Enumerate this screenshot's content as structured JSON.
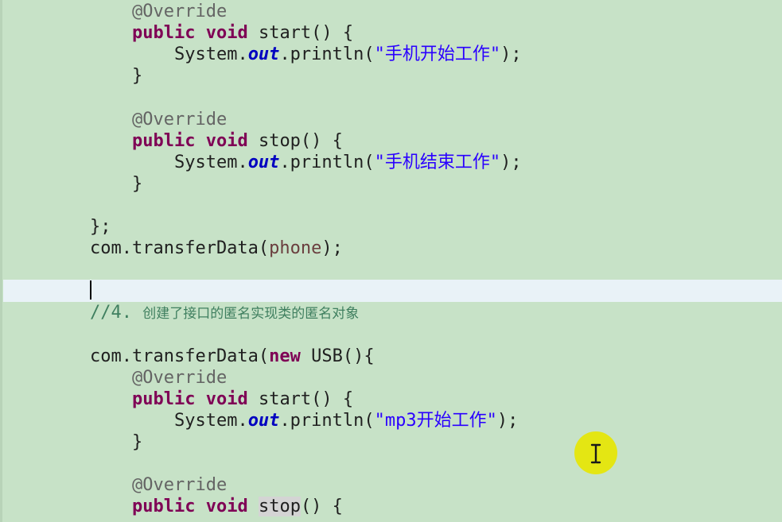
{
  "editor": {
    "lines": [
      {
        "indent": "    ",
        "tokens": [
          {
            "c": "anno",
            "t": "@Override"
          }
        ]
      },
      {
        "indent": "    ",
        "tokens": [
          {
            "c": "kw",
            "t": "public"
          },
          {
            "c": "",
            "t": " "
          },
          {
            "c": "kw",
            "t": "void"
          },
          {
            "c": "",
            "t": " start() {"
          }
        ]
      },
      {
        "indent": "        ",
        "tokens": [
          {
            "c": "",
            "t": "System."
          },
          {
            "c": "static",
            "t": "out"
          },
          {
            "c": "",
            "t": ".println("
          },
          {
            "c": "str",
            "t": "\"手机开始工作\""
          },
          {
            "c": "",
            "t": ");"
          }
        ]
      },
      {
        "indent": "    ",
        "tokens": [
          {
            "c": "",
            "t": "}"
          }
        ]
      },
      {
        "indent": "",
        "tokens": []
      },
      {
        "indent": "    ",
        "tokens": [
          {
            "c": "anno",
            "t": "@Override"
          }
        ]
      },
      {
        "indent": "    ",
        "tokens": [
          {
            "c": "kw",
            "t": "public"
          },
          {
            "c": "",
            "t": " "
          },
          {
            "c": "kw",
            "t": "void"
          },
          {
            "c": "",
            "t": " stop() {"
          }
        ]
      },
      {
        "indent": "        ",
        "tokens": [
          {
            "c": "",
            "t": "System."
          },
          {
            "c": "static",
            "t": "out"
          },
          {
            "c": "",
            "t": ".println("
          },
          {
            "c": "str",
            "t": "\"手机结束工作\""
          },
          {
            "c": "",
            "t": ");"
          }
        ]
      },
      {
        "indent": "    ",
        "tokens": [
          {
            "c": "",
            "t": "}"
          }
        ]
      },
      {
        "indent": "",
        "tokens": []
      },
      {
        "indent": "",
        "tokens": [
          {
            "c": "",
            "t": "};"
          }
        ]
      },
      {
        "indent": "",
        "tokens": [
          {
            "c": "",
            "t": "com.transferData("
          },
          {
            "c": "local",
            "t": "phone"
          },
          {
            "c": "",
            "t": ");"
          }
        ]
      },
      {
        "indent": "",
        "tokens": []
      },
      {
        "indent": "",
        "tokens": []
      },
      {
        "indent": "",
        "tokens": [
          {
            "c": "comment",
            "t": "//4. "
          },
          {
            "c": "comment cjk",
            "t": "创建了接口的匿名实现类的匿名对象"
          }
        ]
      },
      {
        "indent": "",
        "tokens": []
      },
      {
        "indent": "",
        "tokens": [
          {
            "c": "",
            "t": "com.transferData("
          },
          {
            "c": "kw",
            "t": "new"
          },
          {
            "c": "",
            "t": " USB(){"
          }
        ]
      },
      {
        "indent": "    ",
        "tokens": [
          {
            "c": "anno",
            "t": "@Override"
          }
        ]
      },
      {
        "indent": "    ",
        "tokens": [
          {
            "c": "kw",
            "t": "public"
          },
          {
            "c": "",
            "t": " "
          },
          {
            "c": "kw",
            "t": "void"
          },
          {
            "c": "",
            "t": " start() {"
          }
        ]
      },
      {
        "indent": "        ",
        "tokens": [
          {
            "c": "",
            "t": "System."
          },
          {
            "c": "static",
            "t": "out"
          },
          {
            "c": "",
            "t": ".println("
          },
          {
            "c": "str",
            "t": "\"mp3开始工作\""
          },
          {
            "c": "",
            "t": ");"
          }
        ]
      },
      {
        "indent": "    ",
        "tokens": [
          {
            "c": "",
            "t": "}"
          }
        ]
      },
      {
        "indent": "",
        "tokens": []
      },
      {
        "indent": "    ",
        "tokens": [
          {
            "c": "anno",
            "t": "@Override"
          }
        ]
      },
      {
        "indent": "    ",
        "tokens": [
          {
            "c": "kw",
            "t": "public"
          },
          {
            "c": "",
            "t": " "
          },
          {
            "c": "kw",
            "t": "void"
          },
          {
            "c": "",
            "t": " "
          },
          {
            "c": "occ",
            "t": "stop"
          },
          {
            "c": "",
            "t": "() {"
          }
        ]
      }
    ]
  },
  "icons": {
    "pointer": "text-cursor-ibeam-icon"
  },
  "colors": {
    "background": "#c7e2c7",
    "current_line": "#e9f2f7",
    "keyword": "#7f0055",
    "string": "#2a00ff",
    "annotation": "#646464",
    "comment": "#3f7f5f",
    "static_field": "#0000c0",
    "pointer_highlight": "#e6e60a"
  }
}
